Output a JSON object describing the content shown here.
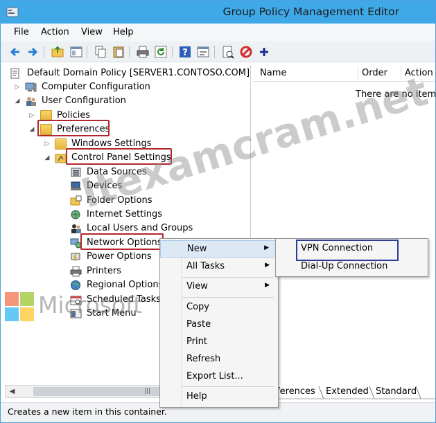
{
  "window": {
    "title": "Group Policy Management Editor"
  },
  "menubar": [
    "File",
    "Action",
    "View",
    "Help"
  ],
  "toolbar_icons": [
    "back-icon",
    "forward-icon",
    "up-folder-icon",
    "show-hide-tree-icon",
    "copy-icon",
    "paste-icon",
    "print-icon",
    "refresh-icon",
    "help-icon",
    "properties-icon",
    "export-icon",
    "stop-icon",
    "add-icon"
  ],
  "tree": {
    "root": "Default Domain Policy [SERVER1.CONTOSO.COM]",
    "computer_configuration": "Computer Configuration",
    "user_configuration": "User Configuration",
    "policies": "Policies",
    "preferences": "Preferences",
    "windows_settings": "Windows Settings",
    "control_panel_settings": "Control Panel Settings",
    "items": [
      "Data Sources",
      "Devices",
      "Folder Options",
      "Internet Settings",
      "Local Users and Groups",
      "Network Options",
      "Power Options",
      "Printers",
      "Regional Options",
      "Scheduled Tasks",
      "Start Menu"
    ]
  },
  "list": {
    "columns": [
      "Name",
      "Order",
      "Action"
    ],
    "empty_message": "There are no items t"
  },
  "tabs": [
    "ferences",
    "Extended",
    "Standard"
  ],
  "status": "Creates a new item in this container.",
  "context_menu": {
    "items": [
      "New",
      "All Tasks",
      "View",
      "Copy",
      "Paste",
      "Print",
      "Refresh",
      "Export List...",
      "Help"
    ],
    "submenu": [
      "VPN Connection",
      "Dial-Up Connection"
    ]
  },
  "watermark": {
    "text": "Itexamcram.net",
    "brand": "Microsoft"
  },
  "colors": {
    "titlebar": "#3fa9e8",
    "highlight_red": "#b3262c",
    "highlight_blue": "#2c3e8f"
  }
}
